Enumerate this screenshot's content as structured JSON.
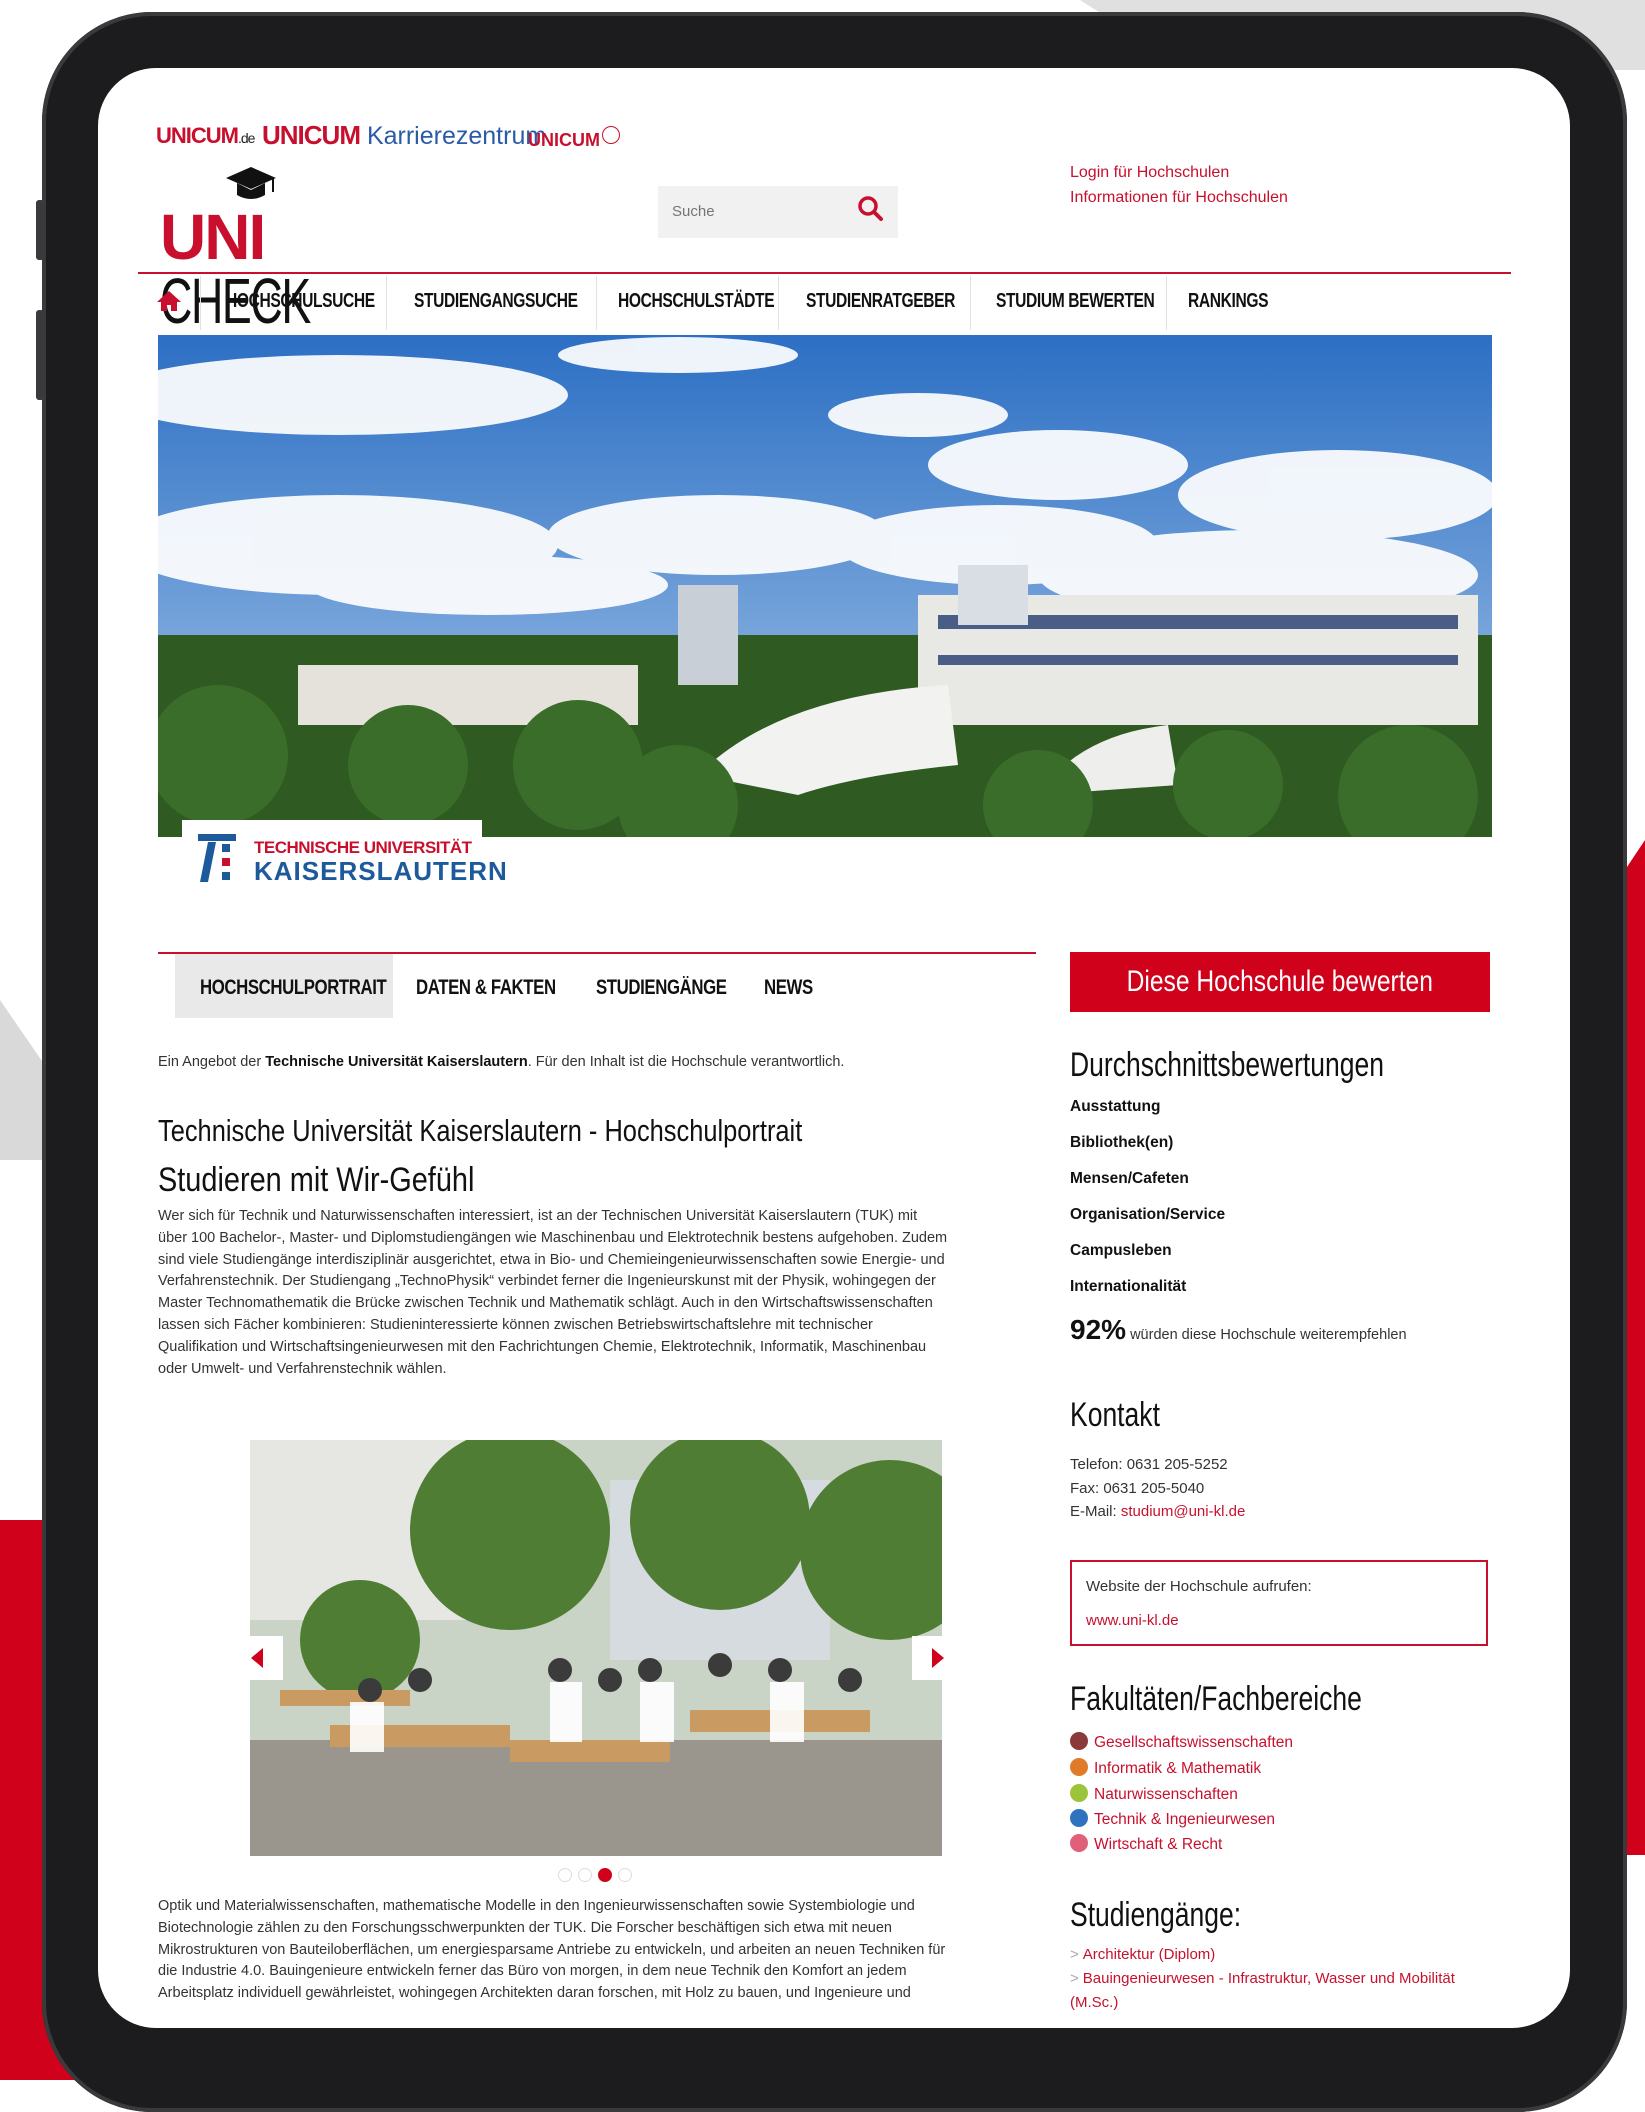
{
  "brand_bar": {
    "unicum_de": "UNICUM",
    "unicum_de_suffix": ".de",
    "unicum_karriere_bold": "UNICUM",
    "unicum_karriere_rest": " Karrierezentrum",
    "unicum_abi": "UNICUM"
  },
  "logo": {
    "uni": "UNI",
    "check": "CHECK"
  },
  "search": {
    "placeholder": "Suche"
  },
  "header_links": {
    "login": "Login für Hochschulen",
    "info": "Informationen für Hochschulen"
  },
  "nav": {
    "items": [
      "HOCHSCHULSUCHE",
      "STUDIENGANGSUCHE",
      "HOCHSCHULSTÄDTE",
      "STUDIENRATGEBER",
      "STUDIUM BEWERTEN",
      "RANKINGS"
    ]
  },
  "university_logo": {
    "line1": "TECHNISCHE UNIVERSITÄT",
    "line2": "KAISERSLAUTERN"
  },
  "tabs": [
    "HOCHSCHULPORTRAIT",
    "DATEN & FAKTEN",
    "STUDIENGÄNGE",
    "NEWS"
  ],
  "main": {
    "offer_prefix": "Ein Angebot der ",
    "offer_bold": "Technische Universität Kaiserslautern",
    "offer_suffix": ". Für den Inhalt ist die Hochschule verantwortlich.",
    "title": "Technische Universität Kaiserslautern - Hochschulportrait",
    "subtitle": "Studieren mit Wir-Gefühl",
    "paragraph1_lines": [
      "Wer sich für Technik und Naturwissenschaften interessiert, ist an der Technischen Universität Kaiserslautern (TUK) mit",
      "über 100 Bachelor-, Master- und Diplomstudiengängen wie Maschinenbau und Elektrotechnik bestens aufgehoben. Zudem",
      "sind viele Studiengänge interdisziplinär ausgerichtet, etwa in Bio- und Chemieingenieurwissenschaften sowie Energie- und",
      "Verfahrenstechnik. Der Studiengang „TechnoPhysik“ verbindet ferner die Ingenieurskunst mit der Physik, wohingegen der",
      "Master Technomathematik die Brücke zwischen Technik und Mathematik schlägt. Auch in den Wirtschaftswissenschaften",
      "lassen sich Fächer kombinieren: Studieninteressierte können zwischen Betriebswirtschaftslehre mit technischer",
      "Qualifikation und Wirtschaftsingenieurwesen mit den Fachrichtungen Chemie, Elektrotechnik, Informatik, Maschinenbau",
      "oder Umwelt- und Verfahrenstechnik wählen."
    ],
    "paragraph2_lines": [
      "Optik und Materialwissenschaften, mathematische Modelle in den Ingenieurwissenschaften sowie Systembiologie und",
      "Biotechnologie zählen zu den Forschungsschwerpunkten der TUK. Die Forscher beschäftigen sich etwa mit neuen",
      "Mikrostrukturen von Bauteiloberflächen, um energiesparsame Antriebe zu entwickeln, und arbeiten an neuen Techniken für",
      "die Industrie 4.0. Bauingenieure entwickeln ferner das Büro von morgen, in dem neue Technik den Komfort an jedem",
      "Arbeitsplatz individuell gewährleistet, wohingegen Architekten daran forschen, mit Holz zu bauen, und Ingenieure und"
    ],
    "carousel_active_index": 3,
    "carousel_total": 4
  },
  "sidebar": {
    "rate_button": "Diese Hochschule bewerten",
    "ratings_title": "Durchschnittsbewertungen",
    "ratings": [
      "Ausstattung",
      "Bibliothek(en)",
      "Mensen/Cafeten",
      "Organisation/Service",
      "Campusleben",
      "Internationalität"
    ],
    "recommend_pct": "92%",
    "recommend_text": " würden diese Hochschule weiterempfehlen",
    "contact_title": "Kontakt",
    "phone": "Telefon: 0631 205-5252",
    "fax": "Fax: 0631 205-5040",
    "email_label": "E-Mail: ",
    "email": "studium@uni-kl.de",
    "website_label": "Website der Hochschule aufrufen:",
    "website": "www.uni-kl.de",
    "faculties_title": "Fakultäten/Fachbereiche",
    "faculties": [
      {
        "label": "Gesellschaftswissenschaften",
        "color": "#8a3a3a"
      },
      {
        "label": "Informatik & Mathematik",
        "color": "#e07b2a"
      },
      {
        "label": "Naturwissenschaften",
        "color": "#9cc43a"
      },
      {
        "label": "Technik & Ingenieurwesen",
        "color": "#2f73c0"
      },
      {
        "label": "Wirtschaft & Recht",
        "color": "#e0607a"
      }
    ],
    "programs_title": "Studiengänge:",
    "programs": [
      "Architektur (Diplom)",
      "Bauingenieurwesen - Infrastruktur, Wasser und Mobilität"
    ],
    "program_suffix": "(M.Sc.)"
  },
  "colors": {
    "accent": "#d0021b",
    "link": "#c8102e",
    "text": "#333333"
  }
}
